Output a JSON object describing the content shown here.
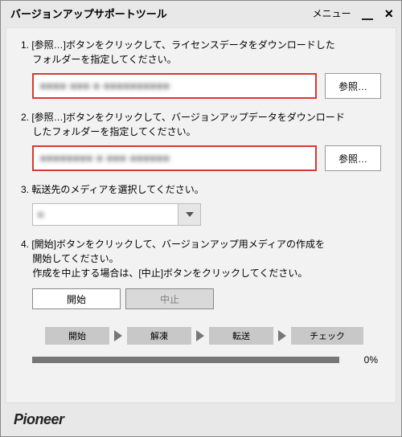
{
  "window": {
    "title": "バージョンアップサポートツール",
    "menu_label": "メニュー"
  },
  "steps": {
    "s1_line1": "1. [参照…]ボタンをクリックして、ライセンスデータをダウンロードした",
    "s1_line2": "フォルダーを指定してください。",
    "s2_line1": "2. [参照…]ボタンをクリックして、バージョンアップデータをダウンロード",
    "s2_line2": "したフォルダーを指定してください。",
    "s3": "3. 転送先のメディアを選択してください。",
    "s4_line1": "4. [開始]ボタンをクリックして、バージョンアップ用メディアの作成を",
    "s4_line2": "開始してください。",
    "s4_line3": "作成を中止する場合は、[中止]ボタンをクリックしてください。"
  },
  "buttons": {
    "browse": "参照…",
    "start": "開始",
    "stop": "中止"
  },
  "stages": {
    "s1": "開始",
    "s2": "解凍",
    "s3": "転送",
    "s4": "チェック"
  },
  "progress": {
    "percent_text": "0%"
  },
  "paths": {
    "license_blur": "■■■■ ■■■ ■ ■■■■■■■■■■",
    "update_blur": "■■■■■■■■ ■ ■■■ ■■■■■■",
    "media_blur": "■"
  },
  "brand": "Pioneer"
}
